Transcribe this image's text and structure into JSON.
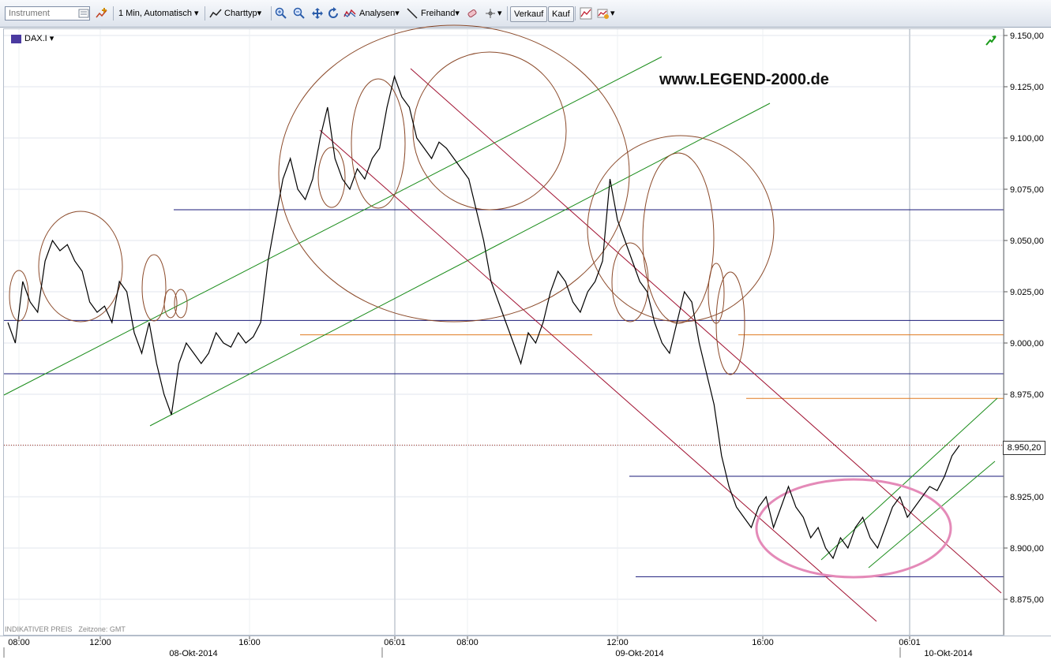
{
  "toolbar": {
    "instrument_placeholder": "Instrument",
    "interval": "1 Min,  Automatisch",
    "charttype": "Charttyp",
    "analysen": "Analysen",
    "freihand": "Freihand",
    "sell": "Verkauf",
    "buy": "Kauf"
  },
  "symbol": "DAX.I",
  "watermark": "www.LEGEND-2000.de",
  "footnote": {
    "left": "INDIKATIVER PREIS",
    "right": "Zeitzone: GMT"
  },
  "last_price_label": "8.950,20",
  "colors": {
    "price": "#000000",
    "hline": "#1a1a7a",
    "orange": "#e07a20",
    "green": "#1a8c1a",
    "red": "#a01030",
    "brown": "#8b4a2a",
    "pink": "#e48ab8"
  },
  "chart_data": {
    "type": "line",
    "title": "DAX.I",
    "ylim": [
      8860,
      9150
    ],
    "y_ticks": [
      "9.150,00",
      "9.125,00",
      "9.100,00",
      "9.075,00",
      "9.050,00",
      "9.025,00",
      "9.000,00",
      "8.975,00",
      "8.950,00",
      "8.925,00",
      "8.900,00",
      "8.875,00"
    ],
    "x_ticks": [
      "08:00",
      "12:00",
      "16:00",
      "06:01",
      "08:00",
      "12:00",
      "16:00",
      "06:01"
    ],
    "date_labels": [
      "08-Okt-2014",
      "09-Okt-2014",
      "10-Okt-2014"
    ],
    "last_price": 8950.2,
    "horizontal_levels": [
      9065,
      9011,
      9004,
      8985,
      8973,
      8935,
      8886
    ],
    "series": [
      {
        "values": [
          9010,
          9000,
          9030,
          9020,
          9015,
          9040,
          9050,
          9045,
          9048,
          9040,
          9035,
          9020,
          9015,
          9018,
          9010,
          9030,
          9025,
          9005,
          8995,
          9010,
          8990,
          8975,
          8965,
          8990,
          9000,
          8995,
          8990,
          8995,
          9005,
          9000,
          8998,
          9005,
          9000,
          9003,
          9010,
          9040,
          9060,
          9080,
          9090,
          9075,
          9070,
          9080,
          9100,
          9115,
          9090,
          9080,
          9075,
          9085,
          9080,
          9090,
          9095,
          9115,
          9130,
          9120,
          9115,
          9100,
          9095,
          9090,
          9098,
          9095,
          9090,
          9085,
          9080,
          9065,
          9050,
          9030,
          9020,
          9010,
          9000,
          8990,
          9005,
          9000,
          9010,
          9025,
          9035,
          9030,
          9020,
          9015,
          9025,
          9030,
          9040,
          9080,
          9060,
          9050,
          9040,
          9030,
          9025,
          9010,
          9000,
          8995,
          9010,
          9025,
          9020,
          9000,
          8985,
          8970,
          8945,
          8930,
          8920,
          8915,
          8910,
          8920,
          8925,
          8910,
          8920,
          8930,
          8920,
          8915,
          8905,
          8910,
          8900,
          8895,
          8905,
          8900,
          8910,
          8915,
          8905,
          8900,
          8910,
          8920,
          8925,
          8915,
          8920,
          8925,
          8930,
          8928,
          8935,
          8945,
          8950
        ]
      }
    ]
  }
}
